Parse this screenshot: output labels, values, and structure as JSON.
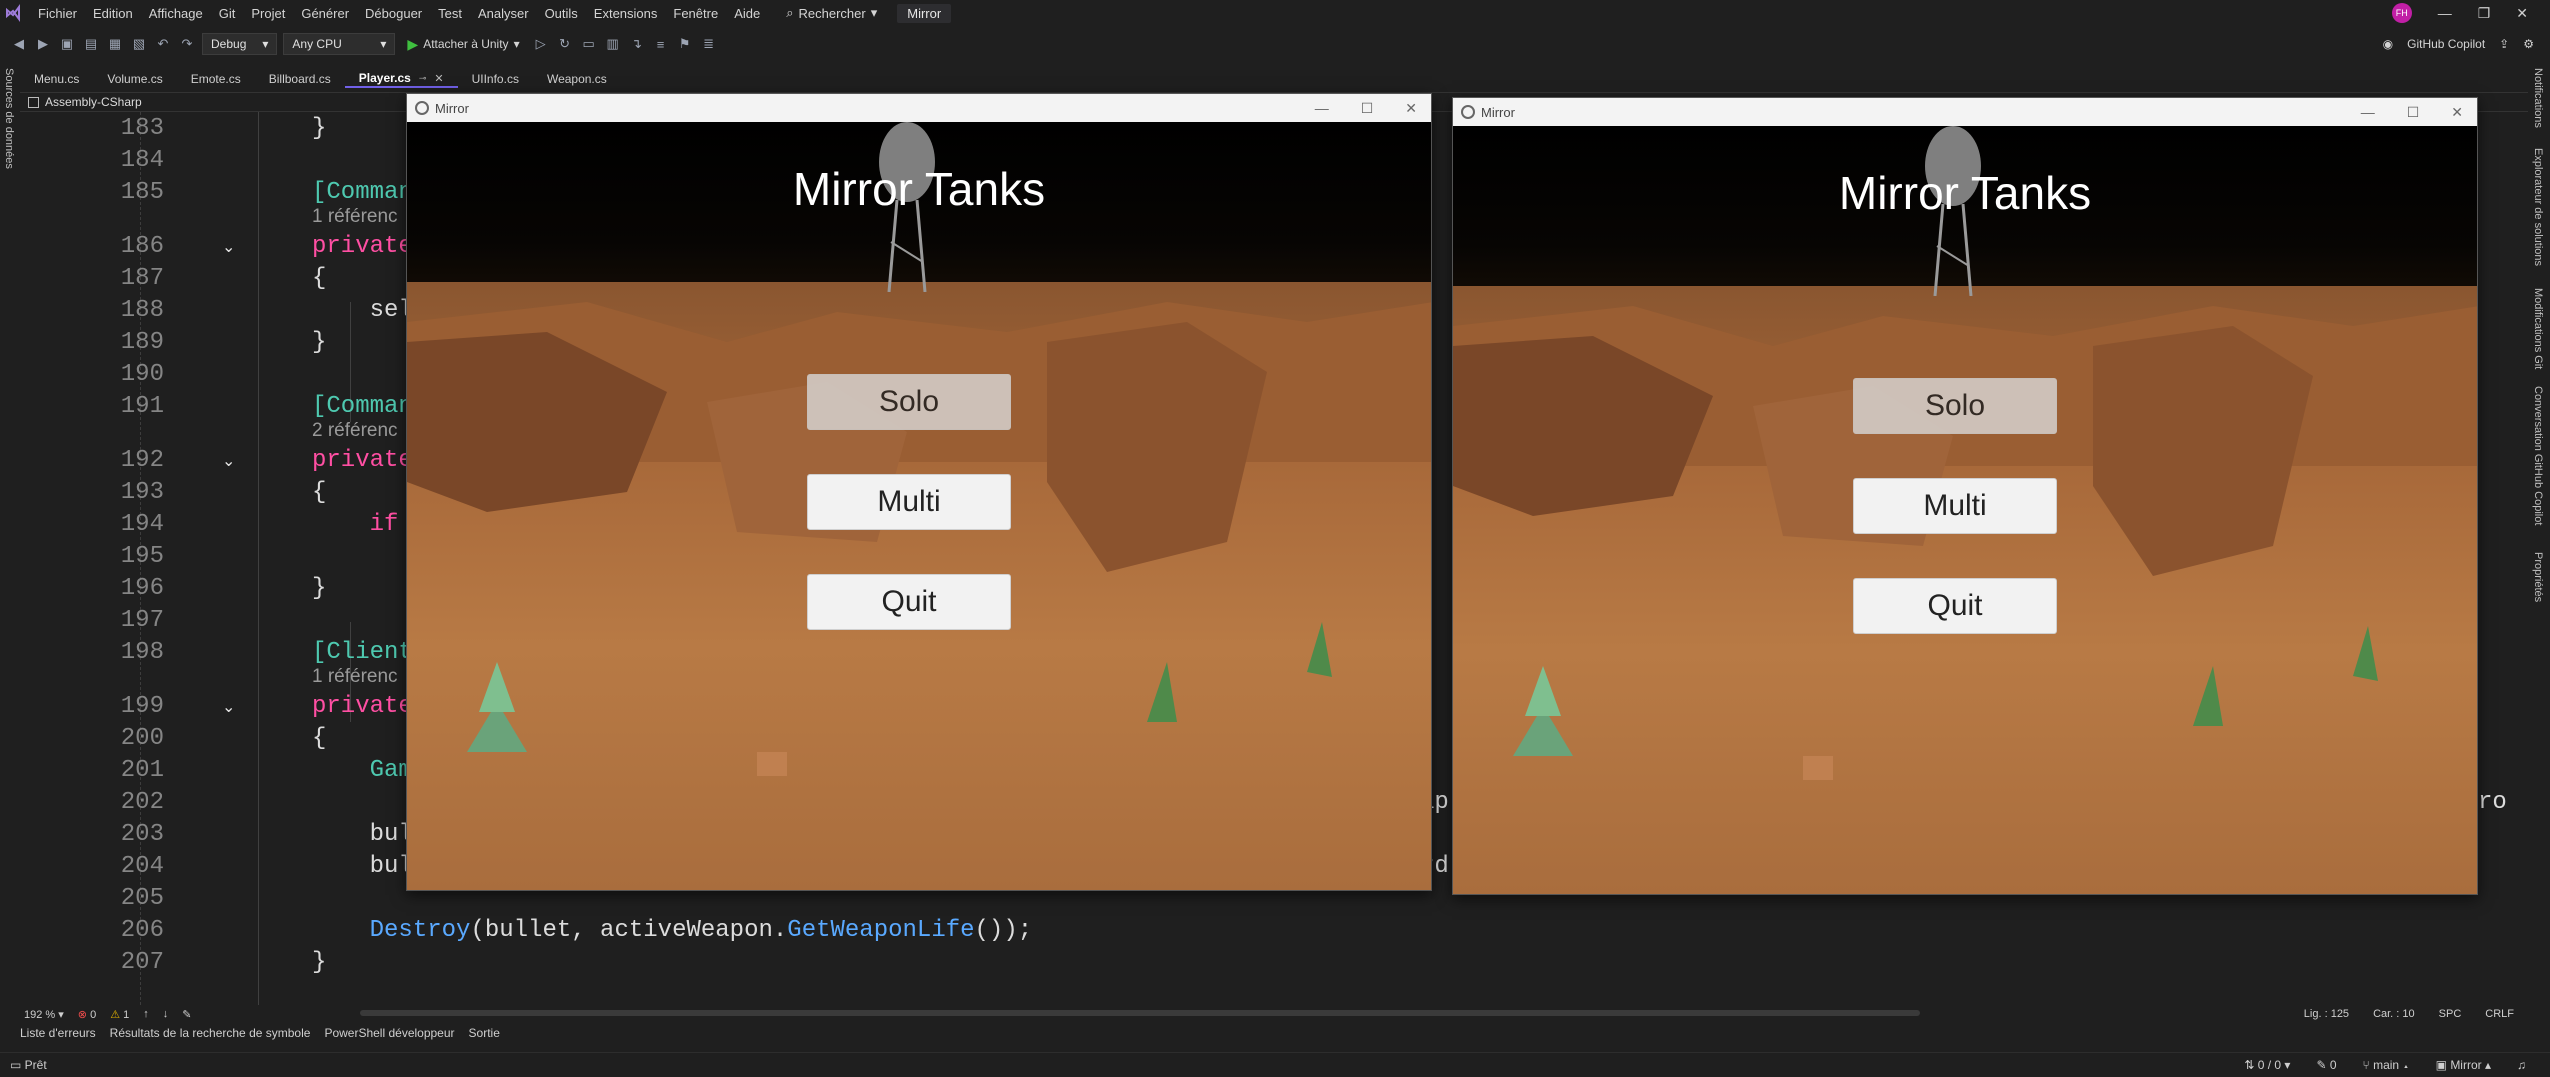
{
  "menubar": {
    "items": [
      "Fichier",
      "Edition",
      "Affichage",
      "Git",
      "Projet",
      "Générer",
      "Déboguer",
      "Test",
      "Analyser",
      "Outils",
      "Extensions",
      "Fenêtre",
      "Aide"
    ],
    "search": "Rechercher",
    "solution": "Mirror",
    "avatar": "FH"
  },
  "toolbar": {
    "config": "Debug",
    "platform": "Any CPU",
    "attach": "Attacher à Unity",
    "copilot": "GitHub Copilot"
  },
  "left_panel": {
    "label": "Sources de données"
  },
  "right_panel": {
    "labels": [
      "Notifications",
      "Explorateur de solutions",
      "Modifications Git",
      "Conversation GitHub Copilot",
      "Propriétés"
    ]
  },
  "tabs": [
    {
      "label": "Menu.cs"
    },
    {
      "label": "Volume.cs"
    },
    {
      "label": "Emote.cs"
    },
    {
      "label": "Billboard.cs"
    },
    {
      "label": "Player.cs",
      "active": true
    },
    {
      "label": "UIInfo.cs"
    },
    {
      "label": "Weapon.cs"
    }
  ],
  "navbar": {
    "project": "Assembly-CSharp"
  },
  "editor": {
    "lines": [
      {
        "num": "183",
        "code": "}"
      },
      {
        "num": "184",
        "code": ""
      },
      {
        "num": "185",
        "code": "[Comman"
      },
      {
        "ref": "1 référenc"
      },
      {
        "num": "186",
        "code": "private"
      },
      {
        "num": "187",
        "code": "{"
      },
      {
        "num": "188",
        "code": "    sel"
      },
      {
        "num": "189",
        "code": "}"
      },
      {
        "num": "190",
        "code": ""
      },
      {
        "num": "191",
        "code": "[Comman"
      },
      {
        "ref": "2 référenc"
      },
      {
        "num": "192",
        "code": "private"
      },
      {
        "num": "193",
        "code": "{"
      },
      {
        "num": "194",
        "code": "    if"
      },
      {
        "num": "195",
        "code": ""
      },
      {
        "num": "196",
        "code": "}"
      },
      {
        "num": "197",
        "code": ""
      },
      {
        "num": "198",
        "code": "[Client"
      },
      {
        "ref": "1 référenc"
      },
      {
        "num": "199",
        "code": "private"
      },
      {
        "num": "200",
        "code": "{"
      },
      {
        "num": "201",
        "code": "    Gam"
      },
      {
        "num": "202",
        "code": ""
      },
      {
        "num": "203",
        "code": "    bul"
      },
      {
        "num": "204",
        "code": "    bullet.name = _name;"
      },
      {
        "num": "205",
        "code": ""
      },
      {
        "num": "206",
        "code": "    Destroy(bullet, activeWeapon.GetWeaponLife());"
      },
      {
        "num": "207",
        "code": "}"
      }
    ],
    "fragment_201": "ap",
    "fragment_201b": "ro",
    "fragment_203": "rd"
  },
  "editor_status": {
    "zoom": "192 %",
    "errors": "0",
    "warnings": "1",
    "line": "Lig. : 125",
    "col": "Car. : 10",
    "spc": "SPC",
    "eol": "CRLF"
  },
  "output_tabs": [
    "Liste d'erreurs",
    "Résultats de la recherche de symbole",
    "PowerShell développeur",
    "Sortie"
  ],
  "statusbar": {
    "ready": "Prêt",
    "sync": "0 / 0",
    "changes": "0",
    "branch": "main",
    "repo": "Mirror"
  },
  "game_windows": [
    {
      "title": "Mirror",
      "heading": "Mirror Tanks",
      "buttons": [
        "Solo",
        "Multi",
        "Quit"
      ]
    },
    {
      "title": "Mirror",
      "heading": "Mirror Tanks",
      "buttons": [
        "Solo",
        "Multi",
        "Quit"
      ]
    }
  ]
}
